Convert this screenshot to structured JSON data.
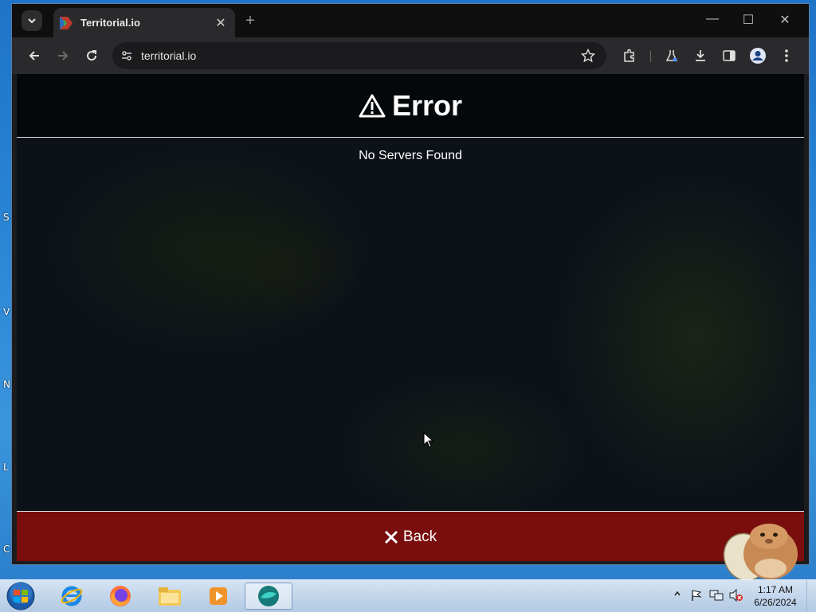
{
  "desktop": {
    "edge_letters": [
      "S",
      "V",
      "N",
      "L",
      "C"
    ]
  },
  "browser": {
    "tab": {
      "title": "Territorial.io"
    },
    "omnibox": {
      "url": "territorial.io"
    }
  },
  "page": {
    "error_title": "Error",
    "message": "No Servers Found",
    "back_label": "Back"
  },
  "taskbar": {
    "clock_time": "1:17 AM",
    "clock_date": "6/26/2024"
  },
  "colors": {
    "back_button": "#7a0d0d",
    "page_bg": "#0c1218",
    "taskbar": "#c3d6ec"
  },
  "icons": {
    "tab_favicon": "territorial-flag-icon",
    "error": "warning-triangle-icon",
    "back": "close-x-icon"
  }
}
